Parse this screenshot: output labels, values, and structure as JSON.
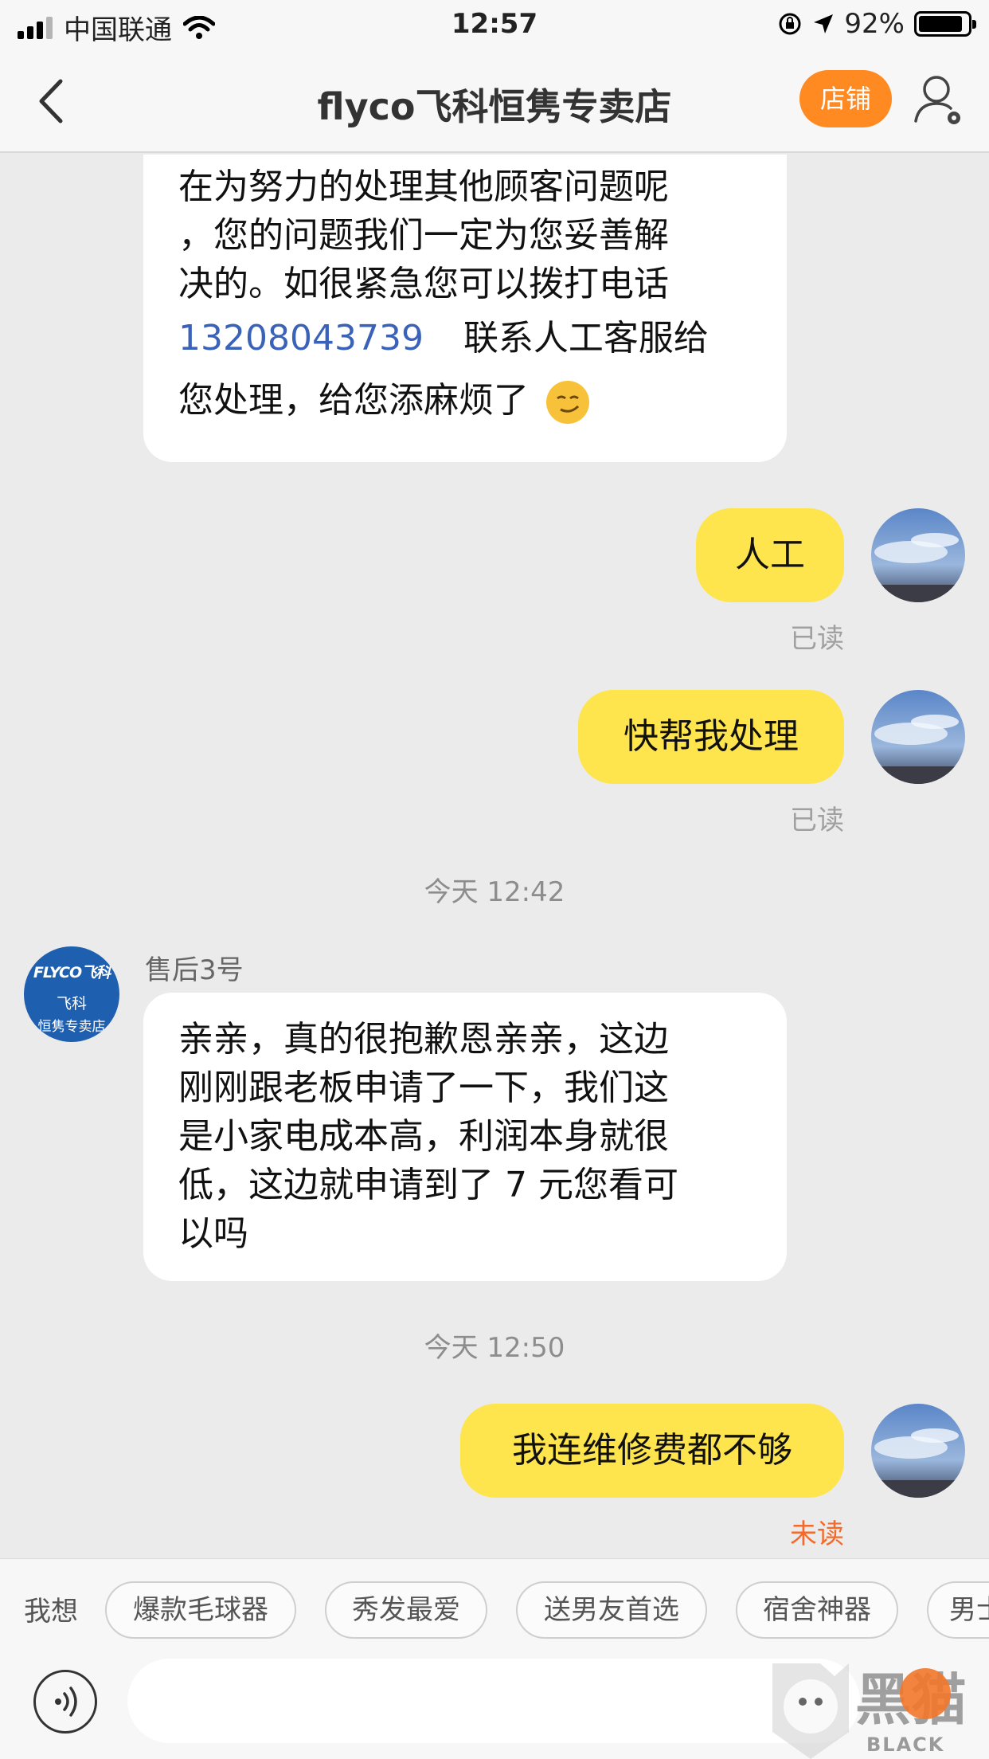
{
  "status_bar": {
    "carrier": "中国联通",
    "time": "12:57",
    "battery": "92%",
    "battery_level": 0.92
  },
  "nav": {
    "title": "flyco飞科恒隽专卖店",
    "shop_button": "店铺",
    "back_icon": "chevron-left-icon",
    "user_icon": "user-settings-icon"
  },
  "messages": {
    "m1": {
      "lines": [
        "在为努力的处理其他顾客问题呢",
        "，您的问题我们一定为您妥善解",
        "决的。如很紧急您可以拨打电话"
      ],
      "phone": "13208043739",
      "after_phone": "联系人工客服给",
      "last_line": "您处理，给您添麻烦了"
    },
    "m2": {
      "text": "人工",
      "status": "已读"
    },
    "m3": {
      "text": "快帮我处理",
      "status": "已读"
    },
    "ts1": "今天 12:42",
    "sender": "售后3号",
    "shop_avatar": {
      "brand": "FLYCO飞科",
      "line1": "飞科",
      "line2": "恒隽专卖店"
    },
    "m4": {
      "lines": [
        "亲亲，真的很抱歉恩亲亲，这边",
        "刚刚跟老板申请了一下，我们这",
        "是小家电成本高，利润本身就很",
        "低，这边就申请到了 7 元您看可",
        "以吗"
      ]
    },
    "ts2": "今天 12:50",
    "m5": {
      "text": "我连维修费都不够",
      "status": "未读"
    }
  },
  "suggestions": {
    "lead": "我想",
    "chips": [
      "爆款毛球器",
      "秀发最爱",
      "送男友首选",
      "宿舍神器",
      "男士"
    ]
  },
  "input": {
    "placeholder": ""
  },
  "watermark": {
    "text": "BLACK CAT"
  },
  "colors": {
    "accent": "#ff8a22",
    "bubble_self": "#ffe54d",
    "link": "#3a62b8",
    "unread": "#f56a2a"
  }
}
